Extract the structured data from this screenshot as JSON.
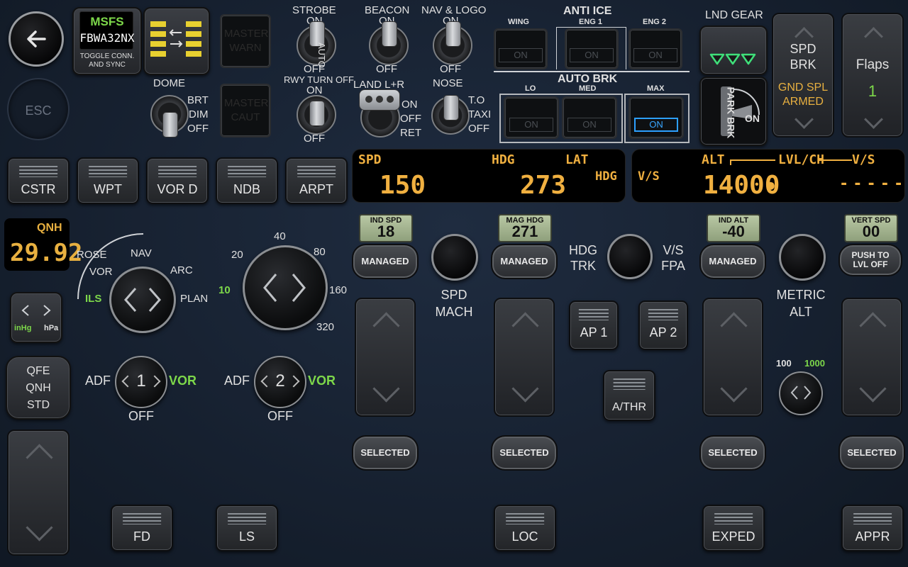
{
  "nav": {
    "back_icon": "arrow-left-icon",
    "esc": "ESC"
  },
  "msfs": {
    "title": "MSFS",
    "aircraft": "FBWA32NX",
    "caption": "TOGGLE CONN. AND SYNC"
  },
  "master": {
    "warn": "MASTER WARN",
    "caut": "MASTER CAUT"
  },
  "dome": {
    "title": "DOME",
    "brt": "BRT",
    "dim": "DIM",
    "off": "OFF"
  },
  "strobe": {
    "title": "STROBE",
    "on": "ON",
    "auto": "AUTO",
    "off": "OFF"
  },
  "beacon": {
    "title": "BEACON",
    "on": "ON",
    "off": "OFF"
  },
  "navlogo": {
    "title": "NAV & LOGO",
    "on": "ON",
    "off": "OFF"
  },
  "rwy": {
    "title": "RWY TURN OFF",
    "on": "ON",
    "off": "OFF"
  },
  "land": {
    "title": "LAND L+R",
    "on": "ON",
    "off": "OFF",
    "ret": "RET"
  },
  "nose": {
    "title": "NOSE",
    "to": "T.O",
    "taxi": "TAXI",
    "off": "OFF"
  },
  "anti_ice": {
    "title": "ANTI ICE",
    "wing": "WING",
    "eng1": "ENG 1",
    "eng2": "ENG 2",
    "on": "ON"
  },
  "auto_brk": {
    "title": "AUTO  BRK",
    "lo": "LO",
    "med": "MED",
    "max": "MAX",
    "on": "ON"
  },
  "gear": {
    "title": "LND GEAR"
  },
  "park": {
    "label": "PARK BRK",
    "on": "ON"
  },
  "spd_brk": {
    "title": "SPD BRK",
    "status": "GND SPL ARMED"
  },
  "flaps": {
    "title": "Flaps",
    "value": "1"
  },
  "efis_buttons": [
    "CSTR",
    "WPT",
    "VOR D",
    "NDB",
    "ARPT"
  ],
  "fcu": {
    "spd_label": "SPD",
    "spd_value": "150",
    "hdg_label": "HDG",
    "hdg_value": "273",
    "lat": "LAT",
    "hdg2": "HDG",
    "vs_label": "V/S",
    "alt_label": "ALT",
    "lvlch": "LVL/CH",
    "vs2": "V/S",
    "alt_value": "14000",
    "alt_dot": "●",
    "vs_value": "-----"
  },
  "qnh": {
    "label": "QNH",
    "value": "29.92",
    "inhg": "inHg",
    "hpa": "hPa",
    "modes": [
      "QFE",
      "QNH",
      "STD"
    ]
  },
  "nd_mode": {
    "rose": "ROSE",
    "nav": "NAV",
    "vor": "VOR",
    "arc": "ARC",
    "ils": "ILS",
    "plan": "PLAN"
  },
  "nd_range": {
    "r10": "10",
    "r20": "20",
    "r40": "40",
    "r80": "80",
    "r160": "160",
    "r320": "320"
  },
  "adf1": {
    "adf": "ADF",
    "num": "1",
    "vor": "VOR",
    "off": "OFF"
  },
  "adf2": {
    "adf": "ADF",
    "num": "2",
    "vor": "VOR",
    "off": "OFF"
  },
  "spd_knob": {
    "lcd_label": "IND SPD",
    "lcd_value": "18",
    "managed": "MANAGED",
    "selected": "SELECTED",
    "caption": "SPD MACH"
  },
  "hdg_knob": {
    "lcd_label": "MAG HDG",
    "lcd_value": "271",
    "managed": "MANAGED",
    "selected": "SELECTED"
  },
  "hdgtrk": {
    "left": "HDG TRK",
    "right": "V/S FPA"
  },
  "alt_knob": {
    "lcd_label": "IND ALT",
    "lcd_value": "-40",
    "managed": "MANAGED",
    "selected": "SELECTED",
    "caption": "METRIC ALT",
    "inc100": "100",
    "inc1000": "1000"
  },
  "vs_knob": {
    "lcd_label": "VERT SPD",
    "lcd_value": "00",
    "push": "PUSH TO LVL OFF",
    "selected": "SELECTED"
  },
  "ap": {
    "ap1": "AP 1",
    "ap2": "AP 2",
    "athr": "A/THR"
  },
  "bottom": {
    "fd": "FD",
    "ls": "LS",
    "loc": "LOC",
    "exped": "EXPED",
    "appr": "APPR"
  }
}
